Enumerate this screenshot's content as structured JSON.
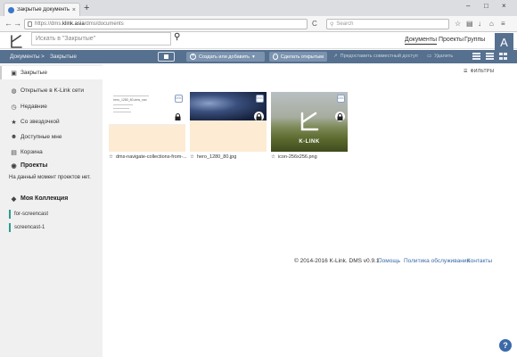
{
  "browser": {
    "tab_title": "Закрытые Документы – К...",
    "tab_close": "×",
    "new_tab": "+",
    "win_min": "–",
    "win_max": "□",
    "win_close": "×",
    "url_prefix": "https://dms.",
    "url_host": "klink.asia",
    "url_path": "/dms/documents",
    "reload": "C",
    "search_placeholder": "Search",
    "back": "←",
    "forward": "→"
  },
  "app": {
    "search_placeholder": "Искать в \"Закрытые\"",
    "nav": [
      "Документы",
      "Проекты",
      "Группы"
    ],
    "avatar_letter": "A"
  },
  "toolbar": {
    "breadcrumb_root": "Документы",
    "breadcrumb_sep": ">",
    "breadcrumb_current": "Закрытые",
    "create_label": "Создать или добавить",
    "make_public_label": "Сделать открытым",
    "share_label": "Предоставить совместный доступ",
    "delete_label": "Удалить"
  },
  "sidebar": {
    "items": [
      "Закрытые",
      "Открытые в K-Link сети",
      "Недавние",
      "Со звездочкой",
      "Доступные мне",
      "Корзина"
    ],
    "projects_heading": "Проекты",
    "projects_note": "На данный момент проектов нет.",
    "collection_heading": "Моя Коллекция",
    "collections": [
      "for-screencast",
      "screencast-1"
    ]
  },
  "main": {
    "filters_label": "ФИЛЬТРЫ",
    "doc_badge": "DOC",
    "logo_text": "K-LINK",
    "cards": [
      {
        "name": "dms-navigate-collections-from-...",
        "thumb_title": "hero_1280_80.dms_nav"
      },
      {
        "name": "hero_1280_80.jpg"
      },
      {
        "name": "icon-256x256.png"
      }
    ]
  },
  "footer": {
    "copyright": "© 2014-2016 K-Link. DMS v0.9.1.",
    "links": [
      "Помощь",
      "Политика обслуживания",
      "Контакты"
    ]
  },
  "help_label": "?"
}
